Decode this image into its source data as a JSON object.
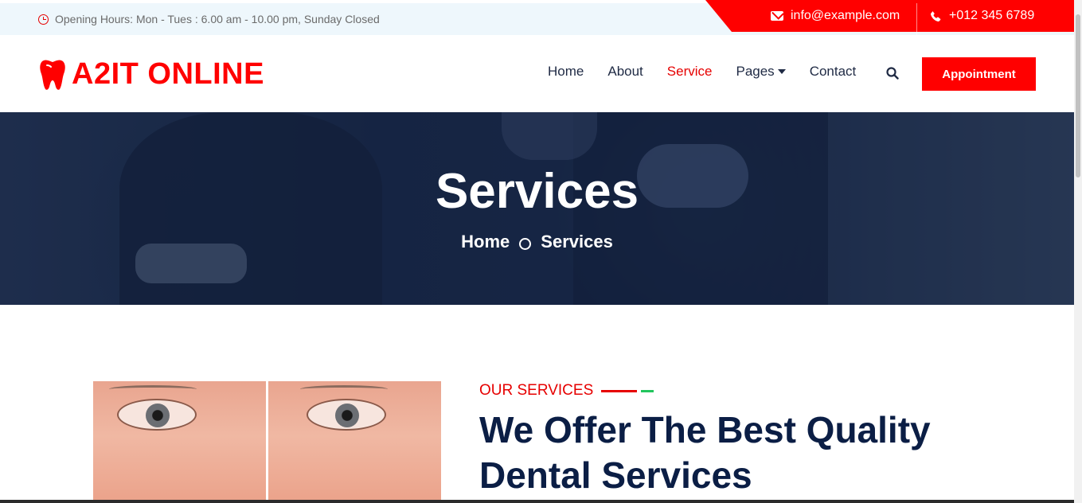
{
  "topbar": {
    "hours": "Opening Hours: Mon - Tues : 6.00 am - 10.00 pm, Sunday Closed",
    "email": "info@example.com",
    "phone": "+012 345 6789"
  },
  "brand": {
    "name": "A2IT ONLINE",
    "color": "#ff0000"
  },
  "nav": {
    "items": [
      {
        "label": "Home",
        "active": false
      },
      {
        "label": "About",
        "active": false
      },
      {
        "label": "Service",
        "active": true
      },
      {
        "label": "Pages",
        "active": false
      },
      {
        "label": "Contact",
        "active": false
      }
    ],
    "appointment": "Appointment"
  },
  "hero": {
    "title": "Services",
    "breadcrumb": [
      "Home",
      "Services"
    ]
  },
  "section": {
    "eyebrow": "OUR SERVICES",
    "headline": "We Offer The Best Quality Dental Services"
  },
  "colors": {
    "accent": "#ff0000",
    "navy": "#0b1e45",
    "topbar": "#eef7fc"
  },
  "icons": [
    "clock-icon",
    "envelope-icon",
    "phone-icon",
    "tooth-icon",
    "search-icon",
    "caret-down-icon"
  ]
}
